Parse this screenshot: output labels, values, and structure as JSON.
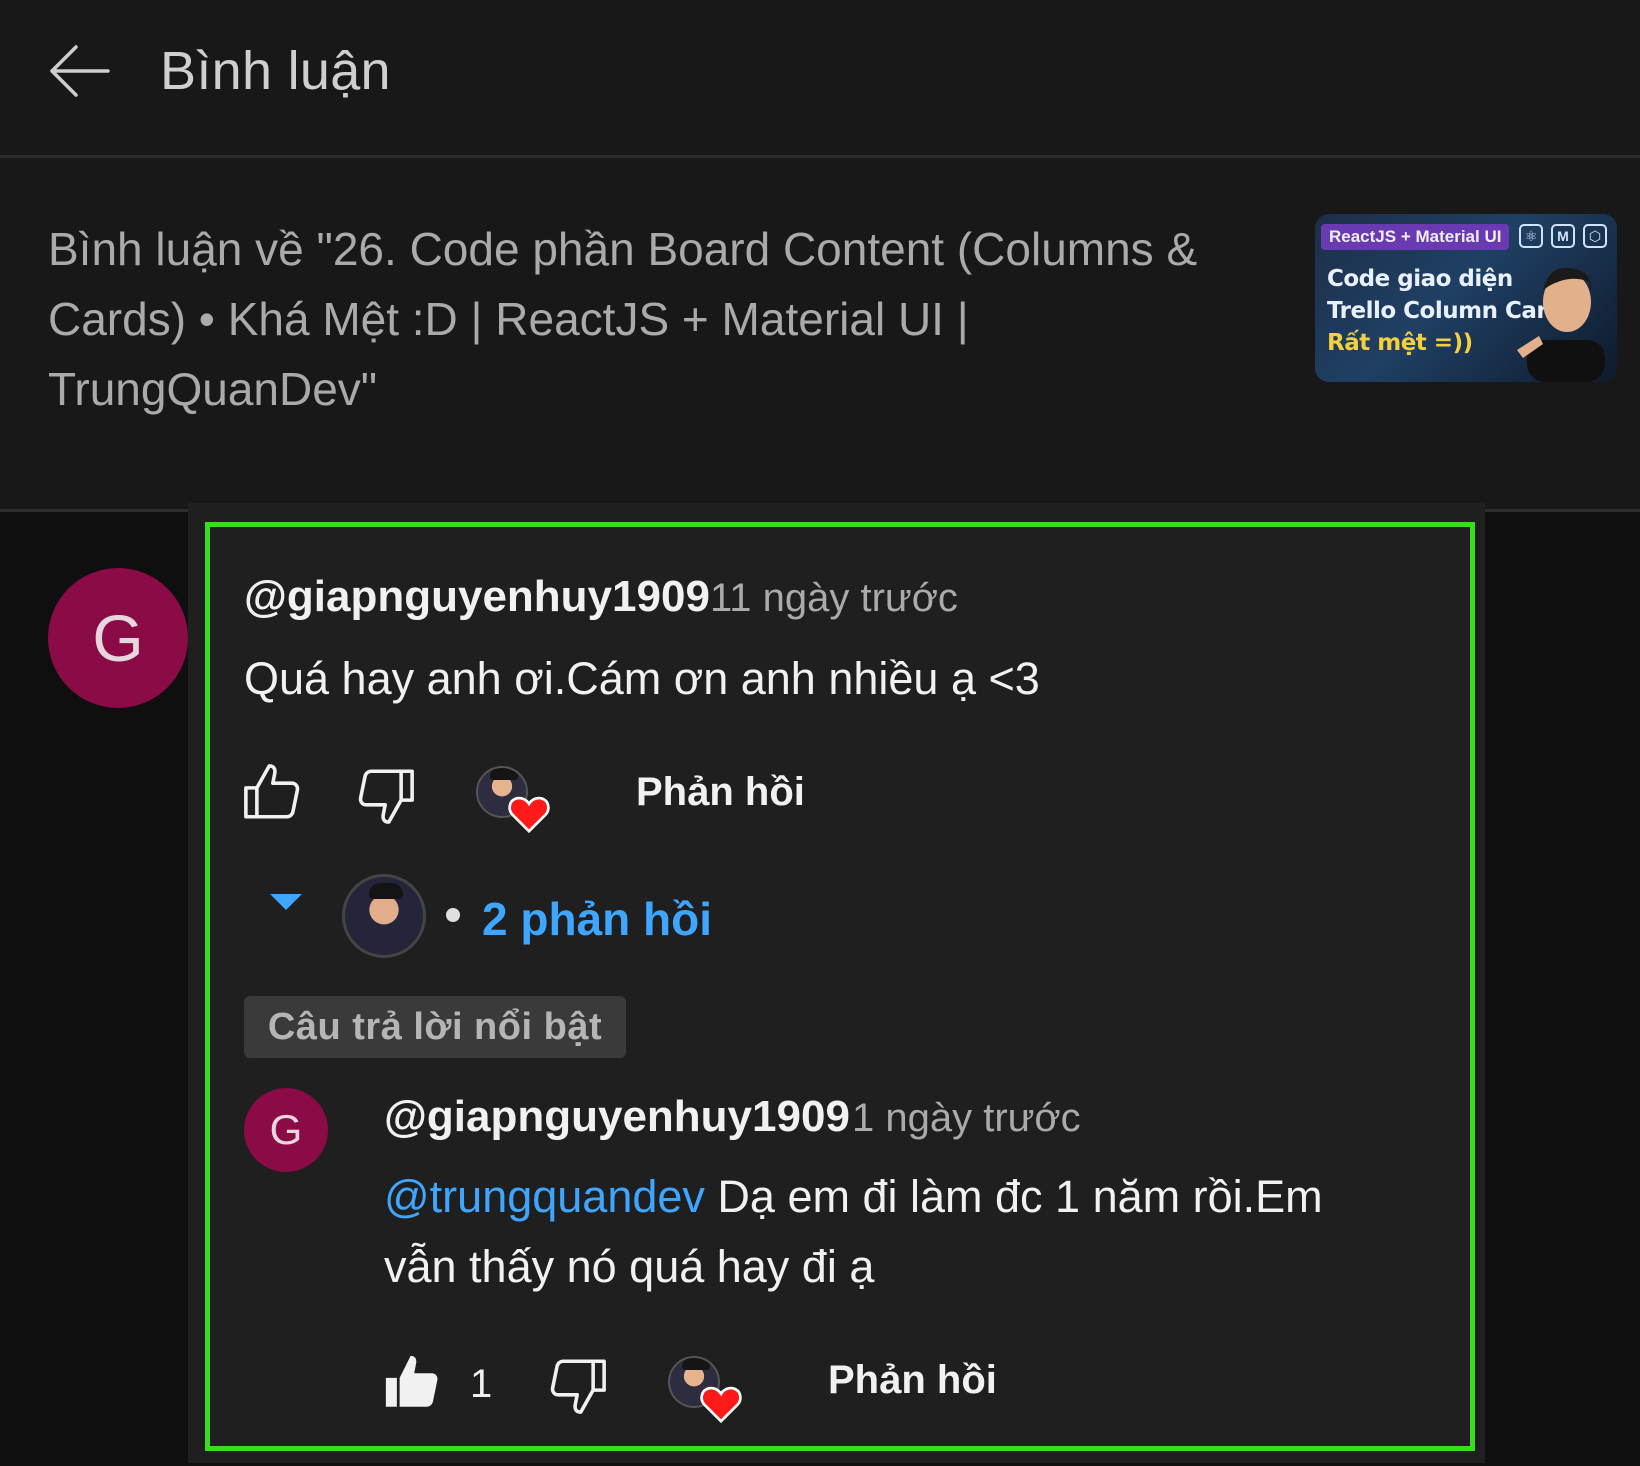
{
  "header": {
    "back_icon": "arrow-left-icon",
    "title": "Bình luận"
  },
  "video": {
    "title": "Bình luận về \"26. Code phần Board Content (Columns & Cards) • Khá Mệt :D | ReactJS + Material UI | TrungQuanDev\"",
    "thumbnail": {
      "tag": "ReactJS + Material UI",
      "line1": "Code giao diện",
      "line2": "Trello Column Card",
      "line3": "Rất mệt =))"
    }
  },
  "comment": {
    "avatar_letter": "G",
    "username": "@giapnguyenhuy1909",
    "time": "11 ngày trước",
    "text": "Quá hay anh ơi.Cám ơn anh nhiều ạ <3",
    "reply_label": "Phản hồi",
    "icons": [
      "thumbs-up-icon",
      "thumbs-down-icon",
      "creator-heart-icon"
    ]
  },
  "replies": {
    "toggle_icon": "caret-down-icon",
    "count_label": "2 phản hồi",
    "featured_label": "Câu trả lời nổi bật"
  },
  "reply": {
    "avatar_letter": "G",
    "username": "@giapnguyenhuy1909",
    "time": "1 ngày trước",
    "mention": "@trungquandev",
    "text_line1": " Dạ em đi làm đc 1 năm rồi.Em",
    "text_line2": "vẫn thấy nó quá hay đi ạ",
    "like_count": "1",
    "reply_label": "Phản hồi"
  },
  "colors": {
    "background": "#0f0f0f",
    "panel": "#181818",
    "thread": "#1f1f1f",
    "avatar": "#8b0b47",
    "link": "#3ea6ff",
    "highlight": "#3bdc1f",
    "heart": "#ff1a1a"
  }
}
